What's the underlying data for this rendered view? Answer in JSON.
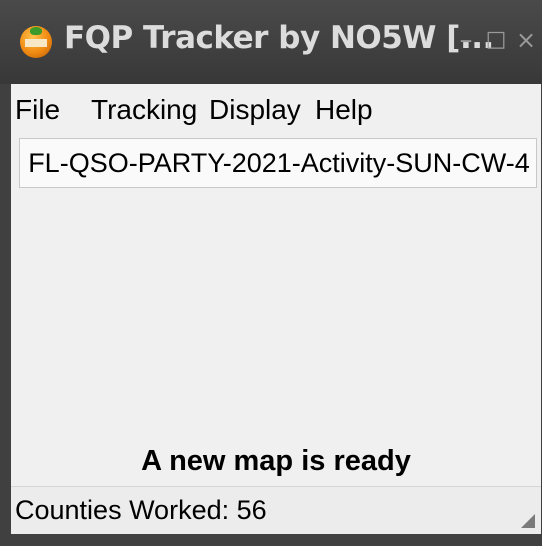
{
  "window": {
    "title": "FQP Tracker by NO5W [...",
    "icon": "fqp-tracker-app-icon",
    "controls": {
      "minimize_glyph": "–",
      "maximize_glyph": "□",
      "close_glyph": "×"
    }
  },
  "menu": {
    "items": [
      {
        "label": "File"
      },
      {
        "label": "Tracking"
      },
      {
        "label": "Display"
      },
      {
        "label": "Help"
      }
    ]
  },
  "activity": {
    "name": "FL-QSO-PARTY-2021-Activity-SUN-CW-4"
  },
  "message": {
    "text": "A new map is ready"
  },
  "status": {
    "counties_worked": "Counties Worked: 56"
  },
  "colors": {
    "titlebar": "#404040",
    "title_text": "#dcdcdc",
    "client_background": "#f0f0f0",
    "app_icon": "#f08a12"
  }
}
